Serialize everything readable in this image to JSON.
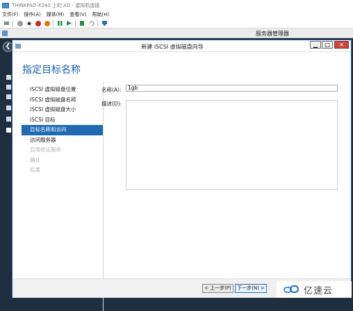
{
  "vm_window": {
    "title": "THINKPAD-X240 上的 AD - 虚拟机连接",
    "menu": [
      "文件(F)",
      "操作(A)",
      "媒体(M)",
      "查看(V)",
      "帮助(H)"
    ]
  },
  "server_manager": {
    "title": "服务器管理器"
  },
  "dialog": {
    "title": "新建 iSCSI 虚拟磁盘向导",
    "heading": "指定目标名称",
    "steps": [
      {
        "label": "iSCSI 虚拟磁盘位置",
        "state": "normal"
      },
      {
        "label": "iSCSI 虚拟磁盘名称",
        "state": "normal"
      },
      {
        "label": "iSCSI 虚拟磁盘大小",
        "state": "normal"
      },
      {
        "label": "iSCSI 目标",
        "state": "normal"
      },
      {
        "label": "目标名称和访问",
        "state": "active"
      },
      {
        "label": "访问服务器",
        "state": "normal"
      },
      {
        "label": "启用验证服务",
        "state": "disabled"
      },
      {
        "label": "确认",
        "state": "disabled"
      },
      {
        "label": "结果",
        "state": "disabled"
      }
    ],
    "name_label": "名称(A):",
    "name_value": "1gb",
    "description_label": "描述(D):",
    "description_value": "",
    "prev_button": "< 上一步(P)",
    "next_button": "下一步(N) >"
  },
  "watermark": {
    "text": "亿速云"
  },
  "colors": {
    "accent": "#1f6ab3",
    "heading": "#1a5fa8"
  }
}
